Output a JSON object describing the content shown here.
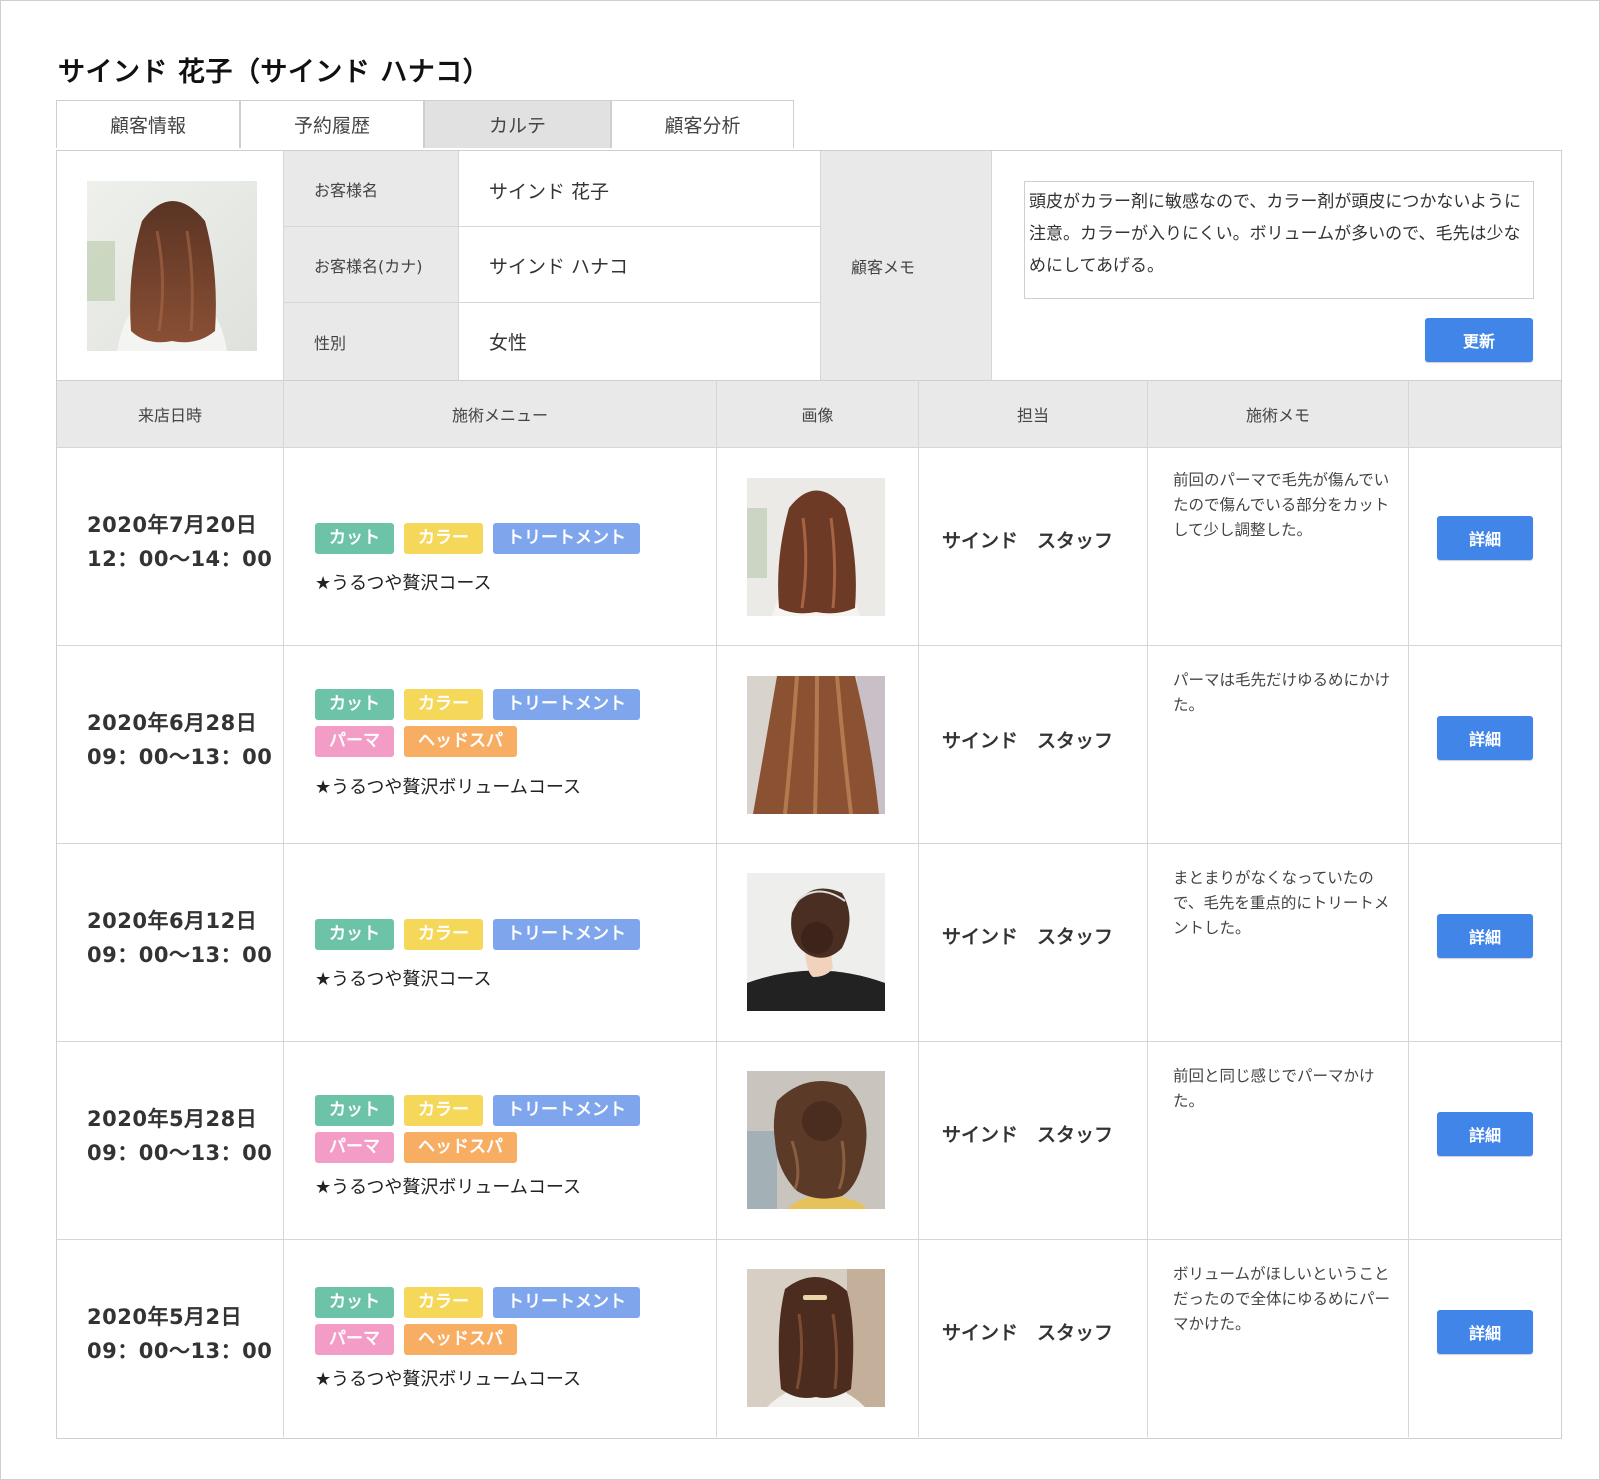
{
  "page_title": "サインド 花子（サインド ハナコ）",
  "tabs": [
    {
      "label": "顧客情報",
      "active": false
    },
    {
      "label": "予約履歴",
      "active": false
    },
    {
      "label": "カルテ",
      "active": true
    },
    {
      "label": "顧客分析",
      "active": false
    }
  ],
  "customer": {
    "name_label": "お客様名",
    "name": "サインド 花子",
    "kana_label": "お客様名(カナ)",
    "kana": "サインド ハナコ",
    "gender_label": "性別",
    "gender": "女性",
    "memo_label": "顧客メモ",
    "memo": "頭皮がカラー剤に敏感なので、カラー剤が頭皮につかないように注意。カラーが入りにくい。ボリュームが多いので、毛先は少なめにしてあげる。",
    "update_label": "更新"
  },
  "table": {
    "headers": [
      "来店日時",
      "施術メニュー",
      "画像",
      "担当",
      "施術メモ"
    ],
    "detail_label": "詳細",
    "rows": [
      {
        "date": "2020年7月20日",
        "time": "12：00〜14：00",
        "tags": [
          "カット",
          "カラー",
          "トリートメント"
        ],
        "course": "★うるつや贅沢コース",
        "staff": "サインド　スタッフ",
        "note": "前回のパーマで毛先が傷んでいたので傷んでいる部分をカットして少し調整した。"
      },
      {
        "date": "2020年6月28日",
        "time": "09：00〜13：00",
        "tags": [
          "カット",
          "カラー",
          "トリートメント",
          "パーマ",
          "ヘッドスパ"
        ],
        "course": "★うるつや贅沢ボリュームコース",
        "staff": "サインド　スタッフ",
        "note": "パーマは毛先だけゆるめにかけた。"
      },
      {
        "date": "2020年6月12日",
        "time": "09：00〜13：00",
        "tags": [
          "カット",
          "カラー",
          "トリートメント"
        ],
        "course": "★うるつや贅沢コース",
        "staff": "サインド　スタッフ",
        "note": "まとまりがなくなっていたので、毛先を重点的にトリートメントした。"
      },
      {
        "date": "2020年5月28日",
        "time": "09：00〜13：00",
        "tags": [
          "カット",
          "カラー",
          "トリートメント",
          "パーマ",
          "ヘッドスパ"
        ],
        "course": "★うるつや贅沢ボリュームコース",
        "staff": "サインド　スタッフ",
        "note": "前回と同じ感じでパーマかけた。"
      },
      {
        "date": "2020年5月2日",
        "time": "09：00〜13：00",
        "tags": [
          "カット",
          "カラー",
          "トリートメント",
          "パーマ",
          "ヘッドスパ"
        ],
        "course": "★うるつや贅沢ボリュームコース",
        "staff": "サインド　スタッフ",
        "note": "ボリュームがほしいということだったので全体にゆるめにパーマかけた。"
      }
    ]
  },
  "tag_colors": {
    "カット": "#6cc3a8",
    "カラー": "#f5d75a",
    "トリートメント": "#7fa6ec",
    "パーマ": "#f39cc6",
    "ヘッドスパ": "#f7ae63"
  },
  "accent_color": "#4285e8"
}
